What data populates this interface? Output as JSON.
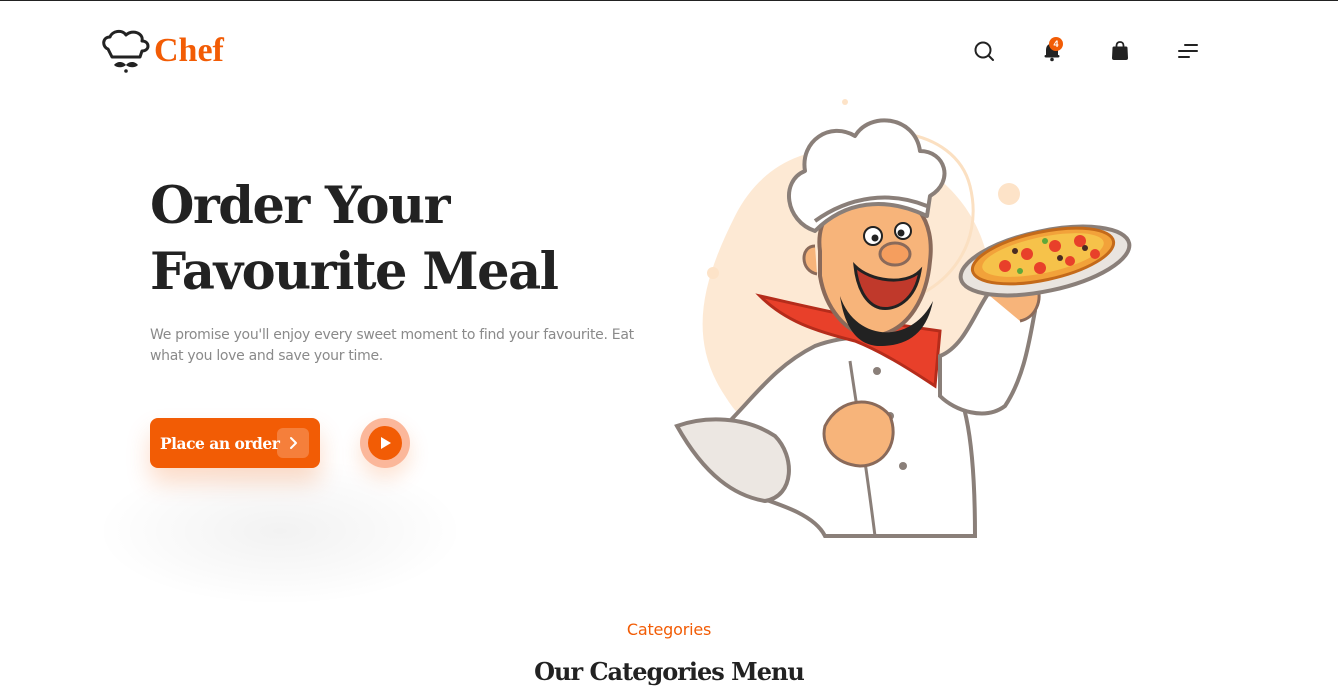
{
  "brand": {
    "name": "Chef",
    "accent": "#f25c05",
    "dark": "#222222"
  },
  "header": {
    "icons": [
      "search-icon",
      "bell-icon",
      "shopping-bag-icon",
      "menu-icon"
    ],
    "notification_count": "4"
  },
  "hero": {
    "title_line1": "Order Your",
    "title_line2": "Favourite Meal",
    "subtitle": "We promise you'll enjoy every sweet moment to find your favourite. Eat what you love and save your time.",
    "order_button": "Place an order",
    "play_button_icon": "play-icon",
    "illustration_icon": "chef-with-pizza-illustration"
  },
  "categories": {
    "eyebrow": "Categories",
    "title": "Our Categories Menu"
  }
}
